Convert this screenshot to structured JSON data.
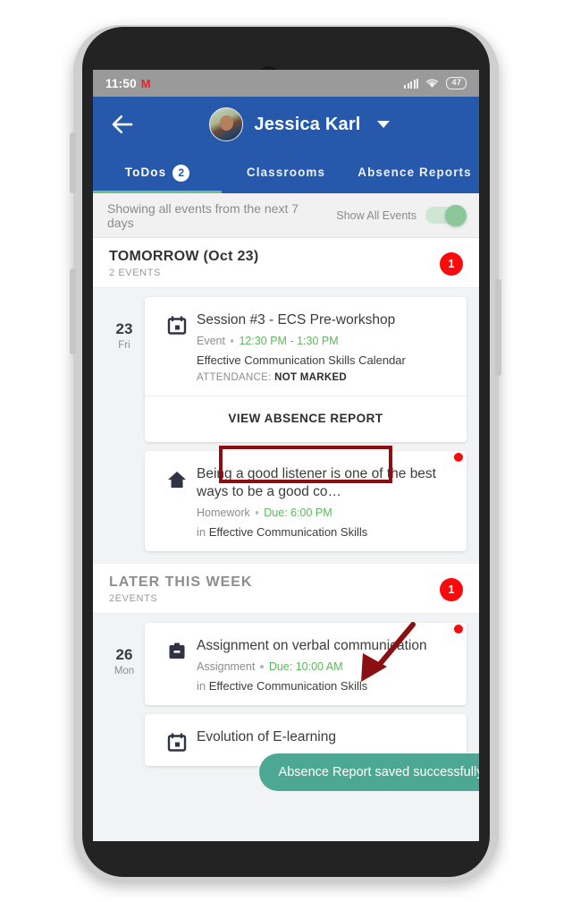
{
  "status_bar": {
    "time": "11:50",
    "app_icon": "mm-icon",
    "signal_icon": "signal-bars-icon",
    "wifi_icon": "wifi-icon",
    "battery_level": "47"
  },
  "app_bar": {
    "back_icon": "back-arrow-icon",
    "avatar": "user-avatar",
    "user_name": "Jessica Karl",
    "dropdown_icon": "chevron-down-icon",
    "brand_color": "#2659ab"
  },
  "tabs": [
    {
      "label": "ToDos",
      "count": "2",
      "active": true
    },
    {
      "label": "Classrooms",
      "count": "",
      "active": false
    },
    {
      "label": "Absence Reports",
      "count": "",
      "active": false
    }
  ],
  "filter_bar": {
    "description": "Showing all events from the next 7 days",
    "toggle_label": "Show All Events",
    "toggle_on": true,
    "toggle_color": "#8cc79a"
  },
  "sections": [
    {
      "title": "TOMORROW (Oct 23)",
      "subtitle": "2 EVENTS",
      "badge": "1",
      "events": [
        {
          "day_number": "23",
          "day_name": "Fri",
          "icon": "calendar-icon",
          "title": "Session #3 - ECS Pre-workshop",
          "kind": "Event",
          "time": "12:30 PM - 1:30 PM",
          "sub_prefix": "",
          "sub": "Effective Communication Skills Calendar",
          "attendance_label": "ATTENDANCE:",
          "attendance_value": "NOT MARKED",
          "action": "VIEW ABSENCE REPORT",
          "unread": false
        },
        {
          "day_number": "",
          "day_name": "",
          "icon": "home-icon",
          "title": "Being a good listener is one of the best ways to be a good co…",
          "kind": "Homework",
          "time": "Due: 6:00 PM",
          "sub_prefix": "in ",
          "sub": "Effective Communication Skills",
          "attendance_label": "",
          "attendance_value": "",
          "action": "",
          "unread": true
        }
      ]
    },
    {
      "title": "LATER THIS WEEK",
      "subtitle": "2EVENTS",
      "badge": "1",
      "events": [
        {
          "day_number": "26",
          "day_name": "Mon",
          "icon": "clipboard-icon",
          "title": "Assignment on verbal communication",
          "kind": "Assignment",
          "time": "Due: 10:00 AM",
          "sub_prefix": "in ",
          "sub": "Effective Communication Skills",
          "attendance_label": "",
          "attendance_value": "",
          "action": "",
          "unread": true
        },
        {
          "day_number": "",
          "day_name": "",
          "icon": "calendar-icon",
          "title": "Evolution of E-learning",
          "kind": "",
          "time": "",
          "sub_prefix": "",
          "sub": "",
          "attendance_label": "",
          "attendance_value": "",
          "action": "",
          "unread": false
        }
      ]
    }
  ],
  "toast": {
    "message": "Absence Report saved successfully",
    "color": "#4da893"
  },
  "annotations": {
    "highlight_target": "VIEW ABSENCE REPORT",
    "arrow_icon": "pointer-arrow-icon",
    "color": "#8b0f12"
  }
}
